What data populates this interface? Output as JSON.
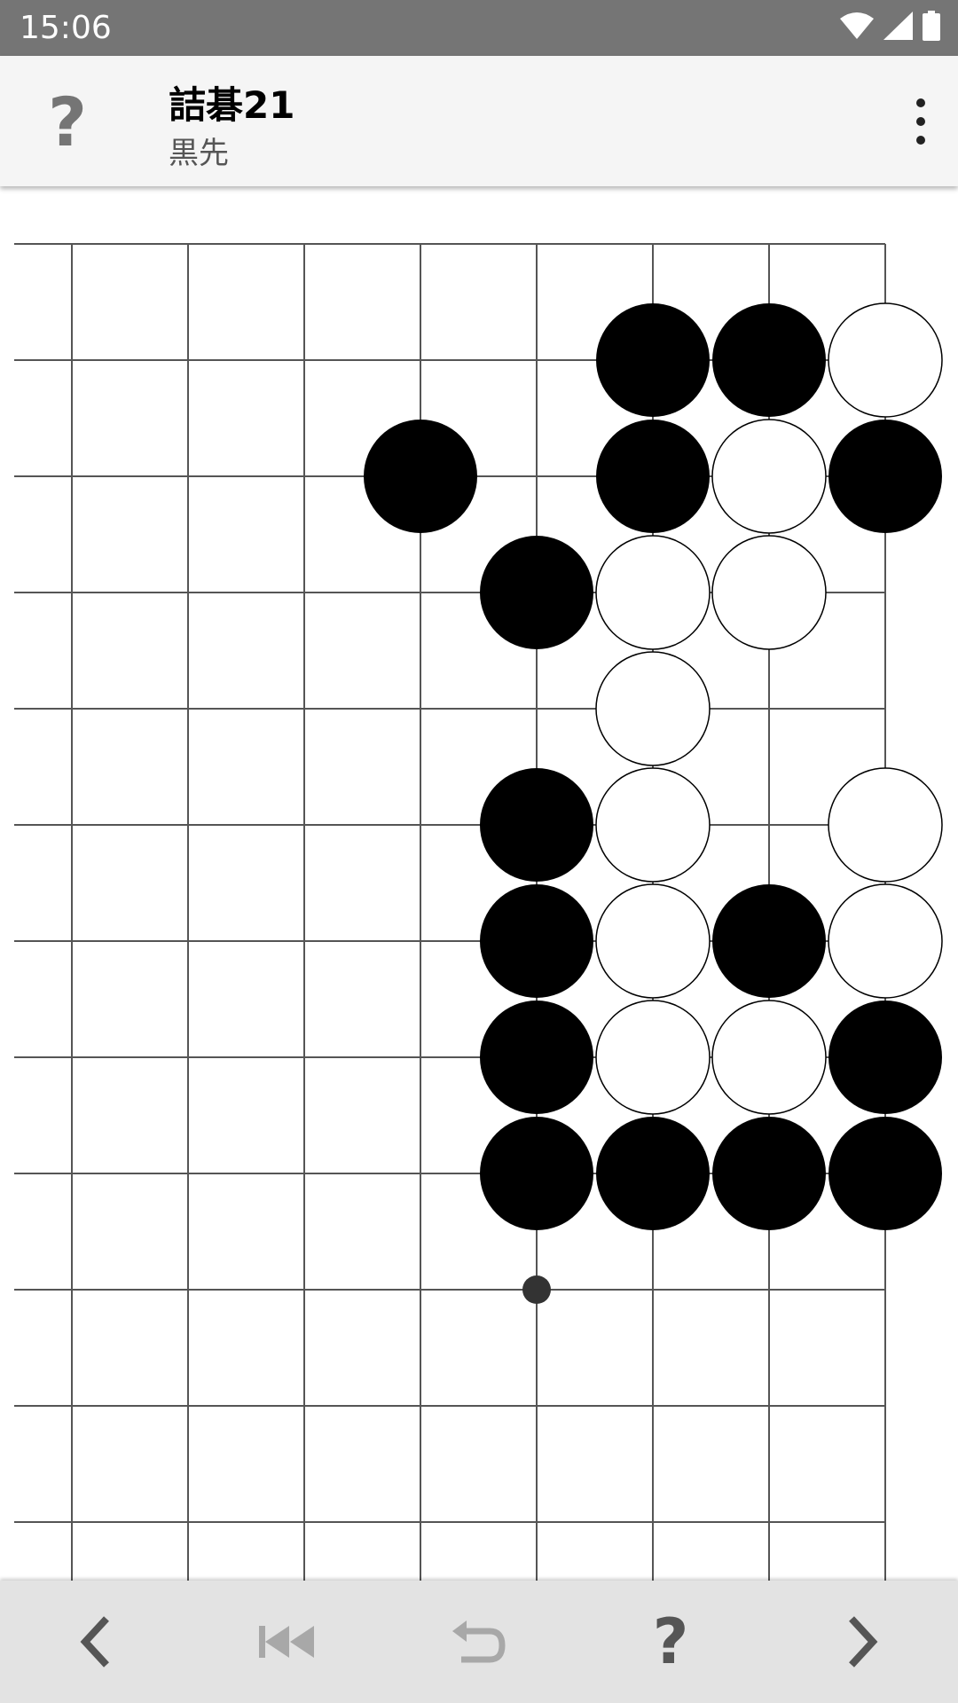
{
  "status_bar": {
    "time": "15:06",
    "icons": [
      "wifi-icon",
      "cell-signal-icon",
      "battery-icon"
    ]
  },
  "app_bar": {
    "help_icon_label": "?",
    "title": "詰碁21",
    "subtitle": "黒先",
    "menu_icon": "more-vertical-icon"
  },
  "board": {
    "visible_columns": 8,
    "visible_rows": 12,
    "star_point": {
      "col": 4,
      "row": 9
    },
    "stones": [
      {
        "col": 5,
        "row": 1,
        "color": "black"
      },
      {
        "col": 6,
        "row": 1,
        "color": "black"
      },
      {
        "col": 7,
        "row": 1,
        "color": "white"
      },
      {
        "col": 3,
        "row": 2,
        "color": "black"
      },
      {
        "col": 5,
        "row": 2,
        "color": "black"
      },
      {
        "col": 6,
        "row": 2,
        "color": "white"
      },
      {
        "col": 7,
        "row": 2,
        "color": "black"
      },
      {
        "col": 4,
        "row": 3,
        "color": "black"
      },
      {
        "col": 5,
        "row": 3,
        "color": "white"
      },
      {
        "col": 6,
        "row": 3,
        "color": "white"
      },
      {
        "col": 5,
        "row": 4,
        "color": "white"
      },
      {
        "col": 4,
        "row": 5,
        "color": "black"
      },
      {
        "col": 5,
        "row": 5,
        "color": "white"
      },
      {
        "col": 7,
        "row": 5,
        "color": "white"
      },
      {
        "col": 4,
        "row": 6,
        "color": "black"
      },
      {
        "col": 5,
        "row": 6,
        "color": "white"
      },
      {
        "col": 6,
        "row": 6,
        "color": "black"
      },
      {
        "col": 7,
        "row": 6,
        "color": "white"
      },
      {
        "col": 4,
        "row": 7,
        "color": "black"
      },
      {
        "col": 5,
        "row": 7,
        "color": "white"
      },
      {
        "col": 6,
        "row": 7,
        "color": "white"
      },
      {
        "col": 7,
        "row": 7,
        "color": "black"
      },
      {
        "col": 4,
        "row": 8,
        "color": "black"
      },
      {
        "col": 5,
        "row": 8,
        "color": "black"
      },
      {
        "col": 6,
        "row": 8,
        "color": "black"
      },
      {
        "col": 7,
        "row": 8,
        "color": "black"
      }
    ]
  },
  "bottom_bar": {
    "buttons": [
      {
        "name": "previous-button",
        "icon": "chevron-left-icon",
        "enabled": true
      },
      {
        "name": "first-move-button",
        "icon": "skip-to-start-icon",
        "enabled": false
      },
      {
        "name": "undo-button",
        "icon": "undo-icon",
        "enabled": false
      },
      {
        "name": "hint-button",
        "icon": "question-mark-icon",
        "enabled": true,
        "label": "?"
      },
      {
        "name": "next-button",
        "icon": "chevron-right-icon",
        "enabled": true
      }
    ]
  },
  "colors": {
    "status_bar": "#757575",
    "app_bar": "#f5f5f5",
    "bottom_bar": "#e3e3e3",
    "grid_line": "#555555",
    "black_stone": "#000000",
    "white_stone": "#ffffff",
    "disabled_icon": "#a8a8a8",
    "enabled_icon": "#555555"
  }
}
